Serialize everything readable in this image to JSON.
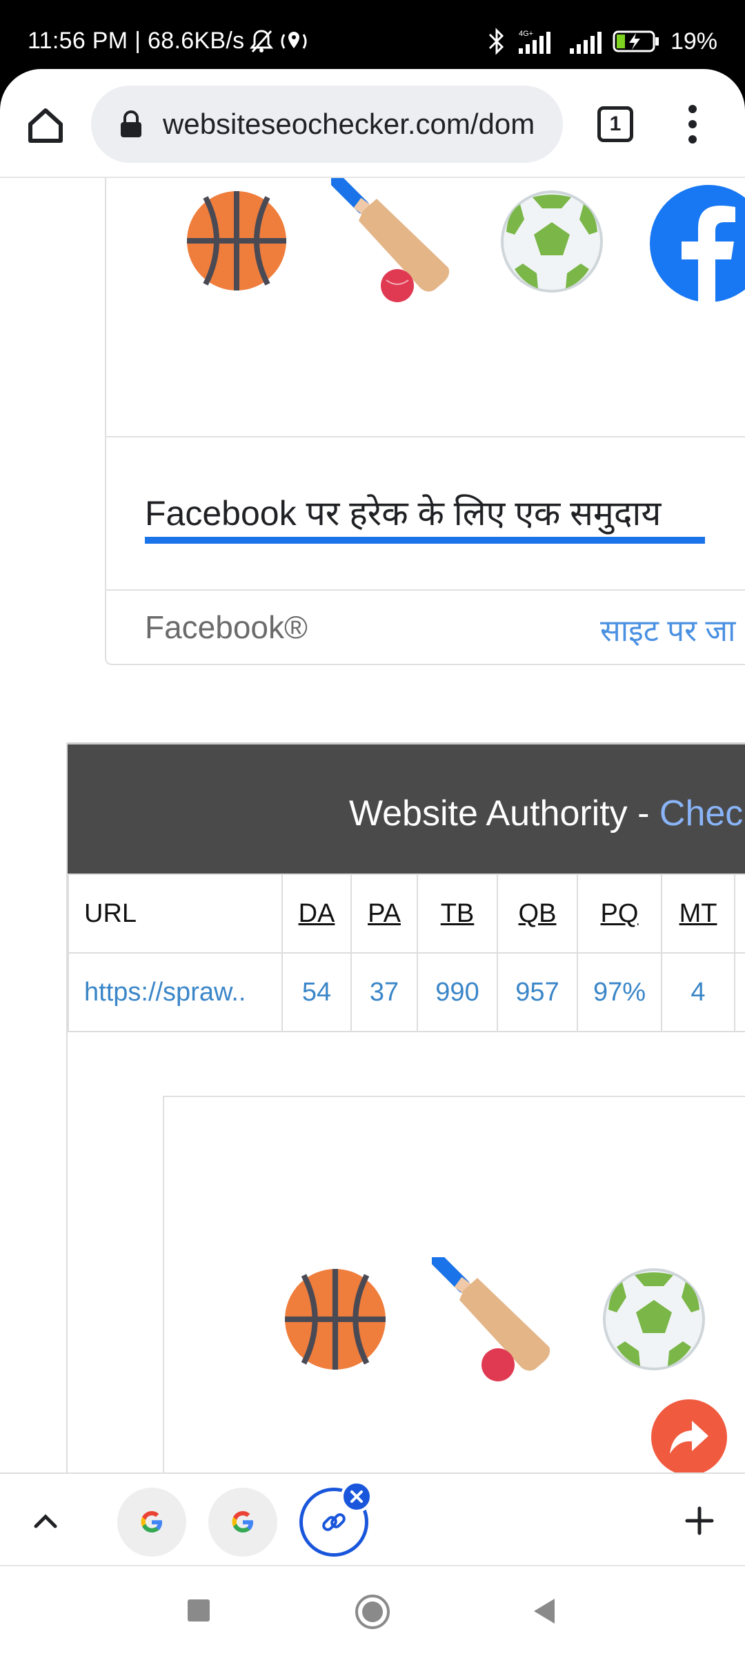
{
  "status_bar": {
    "time_and_speed": "11:56 PM | 68.6KB/s",
    "network_label": "4G+",
    "battery": "19%"
  },
  "browser": {
    "url": "websiteseochecker.com/dom",
    "tab_count": "1"
  },
  "ad": {
    "headline": "Facebook पर हरेक के लिए एक समुदाय",
    "brand": "Facebook®",
    "cta": "साइट पर जा",
    "icons": [
      "basketball-icon",
      "cricket-bat-icon",
      "soccer-ball-icon",
      "facebook-logo-icon"
    ],
    "colors": {
      "accent": "#1a73e8",
      "cta": "#4a90e2"
    }
  },
  "authority": {
    "title_prefix": "Website Authority - ",
    "title_link": "Chec",
    "headers": [
      "URL",
      "DA",
      "PA",
      "TB",
      "QB",
      "PQ",
      "MT"
    ],
    "row": [
      "https://spraw..",
      "54",
      "37",
      "990",
      "957",
      "97%",
      "4"
    ]
  },
  "fab": {
    "icon": "share-arrow-icon",
    "color": "#f05a3f"
  },
  "tab_strip": {
    "tabs": [
      "google-icon",
      "google-icon",
      "link-icon"
    ]
  }
}
